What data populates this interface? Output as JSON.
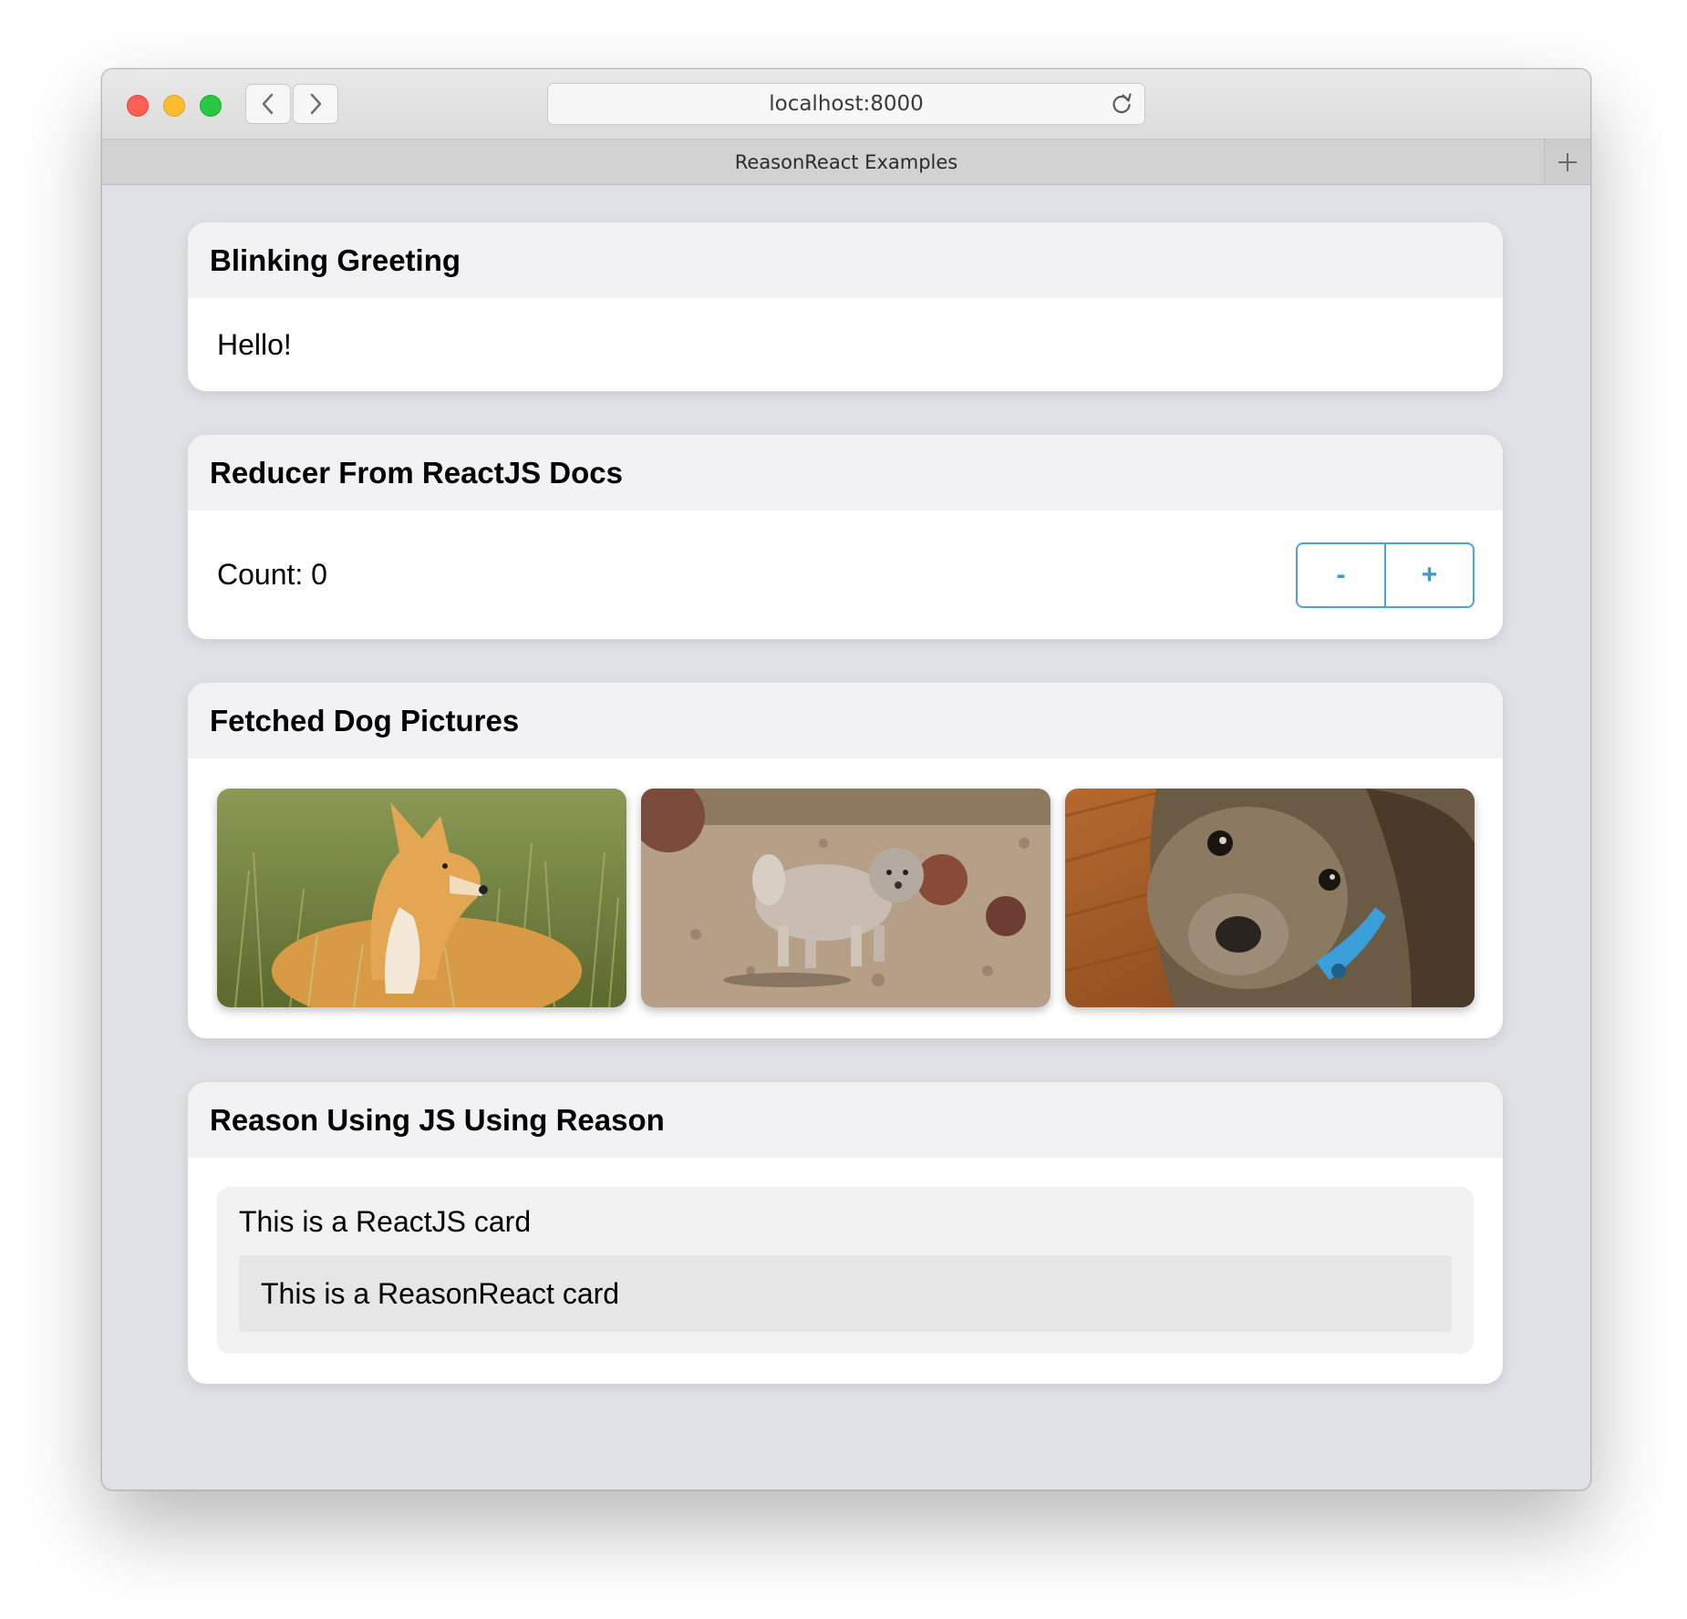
{
  "browser": {
    "url": "localhost:8000",
    "tab_title": "ReasonReact Examples",
    "icons": {
      "back": "chevron-left-icon",
      "forward": "chevron-right-icon",
      "reload": "reload-icon",
      "new_tab": "plus-icon"
    }
  },
  "cards": {
    "greeting": {
      "title": "Blinking Greeting",
      "text": "Hello!"
    },
    "reducer": {
      "title": "Reducer From ReactJS Docs",
      "count_text": "Count: 0",
      "decrement_label": "-",
      "increment_label": "+",
      "accent_color": "#3c9ad3"
    },
    "dogs": {
      "title": "Fetched Dog Pictures",
      "images": [
        "dingo in grass",
        "small shaggy dog on gravel",
        "terrier puppy with blue collar"
      ]
    },
    "reason_js": {
      "title": "Reason Using JS Using Reason",
      "reactjs_card_text": "This is a ReactJS card",
      "reasonreact_card_text": "This is a ReasonReact card"
    }
  }
}
